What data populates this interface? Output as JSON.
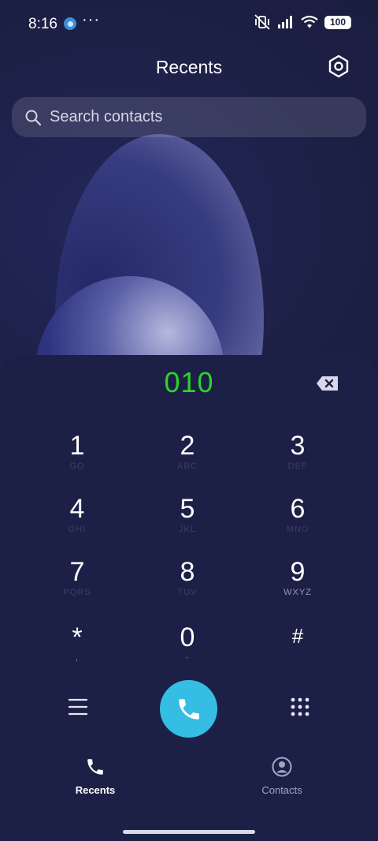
{
  "status": {
    "time": "8:16",
    "more": "···",
    "battery": "100"
  },
  "header": {
    "title": "Recents"
  },
  "search": {
    "placeholder": "Search contacts"
  },
  "dialer": {
    "number": "010",
    "keys": [
      {
        "digit": "1",
        "letters": "GO"
      },
      {
        "digit": "2",
        "letters": "ABC"
      },
      {
        "digit": "3",
        "letters": "DEF"
      },
      {
        "digit": "4",
        "letters": "GHI"
      },
      {
        "digit": "5",
        "letters": "JKL"
      },
      {
        "digit": "6",
        "letters": "MNO"
      },
      {
        "digit": "7",
        "letters": "PQRS"
      },
      {
        "digit": "8",
        "letters": "TUV"
      },
      {
        "digit": "9",
        "letters": "WXYZ"
      },
      {
        "digit": "*",
        "letters": ","
      },
      {
        "digit": "0",
        "letters": "+"
      },
      {
        "digit": "#",
        "letters": ""
      }
    ]
  },
  "nav": {
    "recents": "Recents",
    "contacts": "Contacts"
  },
  "colors": {
    "background": "#1d2046",
    "number": "#2ad42a",
    "call": "#36bde3"
  }
}
